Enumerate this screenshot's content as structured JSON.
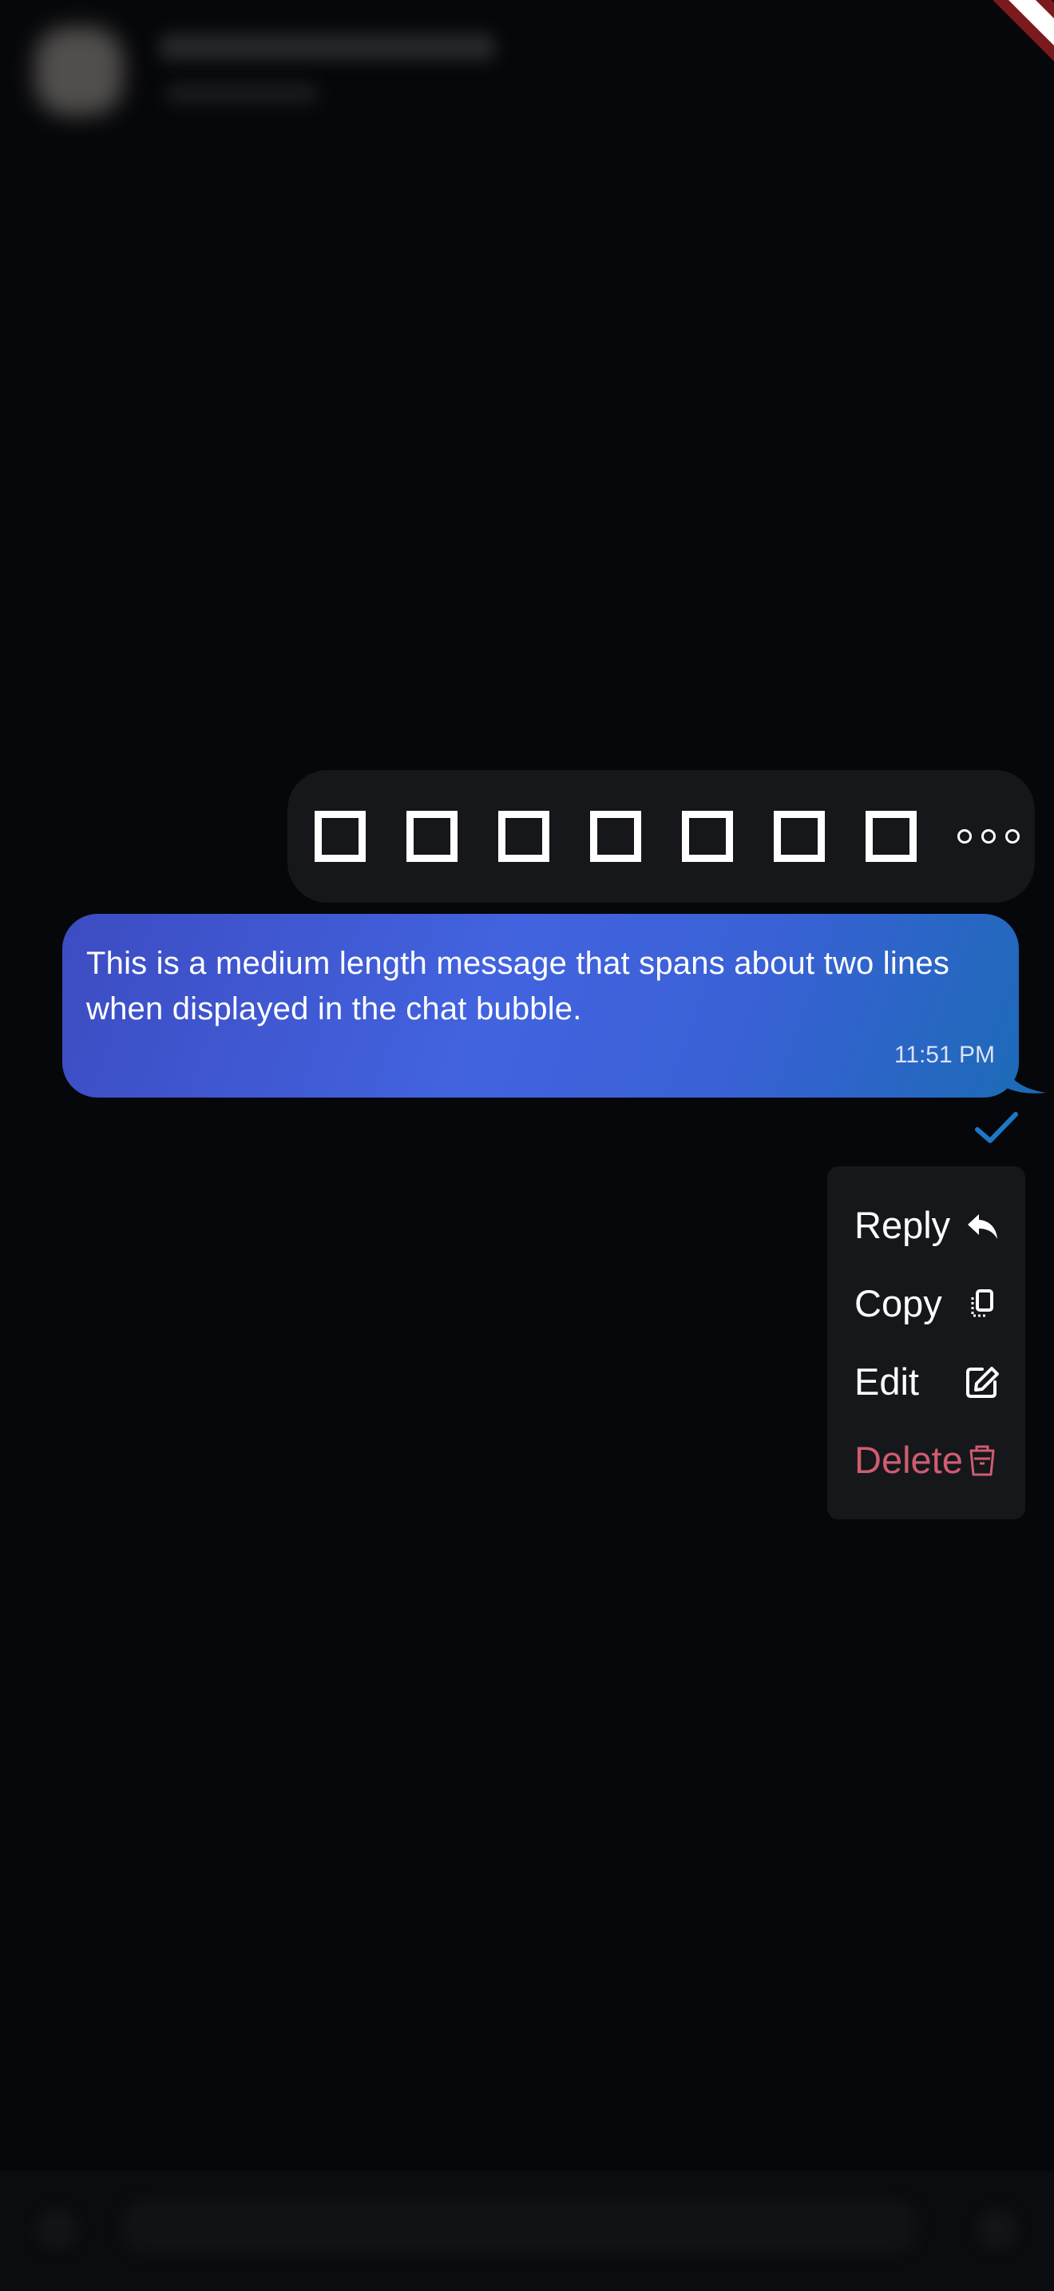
{
  "chat": {
    "header": {
      "title": "",
      "subtitle": ""
    },
    "message": {
      "text": "This is a medium length message that spans about two lines when displayed in the chat bubble.",
      "time": "11:51 PM",
      "status": "sent",
      "bubble_colors": [
        "#3d4cc2",
        "#4263df",
        "#1d6ab8"
      ]
    },
    "reactions": {
      "count": 7,
      "glyph": "□",
      "more_icon": "more-horizontal-icon"
    },
    "context_menu": {
      "items": [
        {
          "label": "Reply",
          "icon": "reply-icon"
        },
        {
          "label": "Copy",
          "icon": "copy-icon"
        },
        {
          "label": "Edit",
          "icon": "edit-icon"
        },
        {
          "label": "Delete",
          "icon": "trash-icon",
          "color": "#cf5c71"
        }
      ]
    },
    "check_color": "#1d78c8",
    "debug_banner_color": "#7b1a1d"
  }
}
